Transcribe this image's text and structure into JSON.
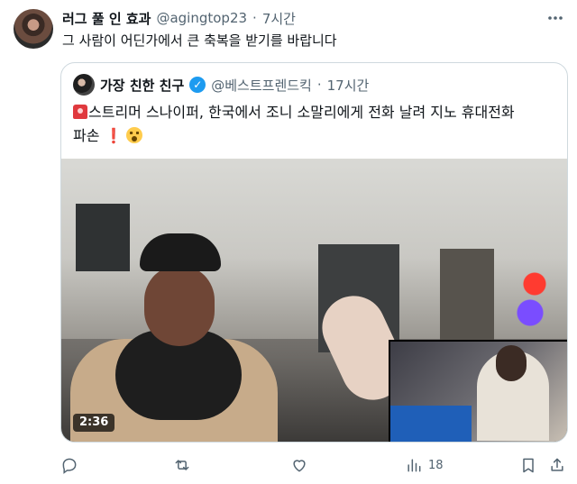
{
  "tweet": {
    "author_name": "러그 풀 인 효과",
    "author_handle": "@agingtop23",
    "separator": "·",
    "time": "7시간",
    "text": "그 사람이 어딘가에서 큰 축복을 받기를 바랍니다"
  },
  "quote": {
    "author_name": "가장 친한 친구",
    "author_handle": "@베스트프렌드킥",
    "separator": "·",
    "time": "17시간",
    "text_line1": "스트리머 스나이퍼, 한국에서 조니 소말리에게 전화 날려 지노 휴대전화",
    "text_line2": "파손",
    "video_duration": "2:36"
  },
  "actions": {
    "views_count": "18"
  },
  "icons": {
    "more": "more-icon",
    "verified": "verified-badge-icon",
    "reply": "reply-icon",
    "retweet": "retweet-icon",
    "like": "like-icon",
    "views": "views-icon",
    "bookmark": "bookmark-icon",
    "share": "share-icon"
  },
  "colors": {
    "verified_blue": "#1d9bf0",
    "secondary_text": "#536471",
    "border": "#cfd9de"
  }
}
